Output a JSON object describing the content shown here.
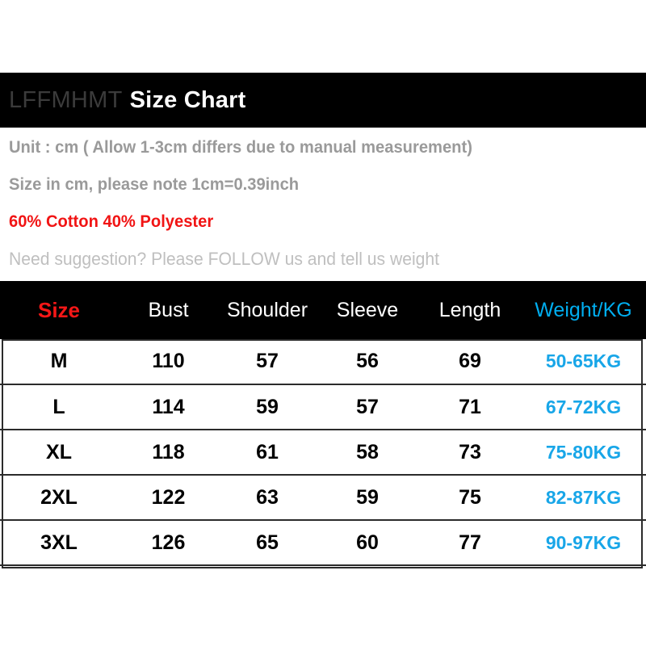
{
  "header": {
    "brand": "LFFMHMT",
    "title": "Size Chart"
  },
  "info": {
    "line_unit": "Unit : cm ( Allow 1-3cm differs due to manual measurement)",
    "line_conversion": "Size in cm, please note 1cm=0.39inch",
    "line_material": "60% Cotton 40% Polyester",
    "line_suggestion": "Need suggestion? Please FOLLOW us and tell us weight"
  },
  "colors": {
    "accent_red": "#f51717",
    "accent_cyan": "#00aef0",
    "header_bg": "#000000",
    "body_text": "#000000",
    "muted_gray": "#9a9a9a",
    "light_gray": "#bfbfbf"
  },
  "chart_data": {
    "type": "table",
    "title": "Size Chart",
    "columns": [
      "Size",
      "Bust",
      "Shoulder",
      "Sleeve",
      "Length",
      "Weight/KG"
    ],
    "rows": [
      [
        "M",
        "110",
        "57",
        "56",
        "69",
        "50-65KG"
      ],
      [
        "L",
        "114",
        "59",
        "57",
        "71",
        "67-72KG"
      ],
      [
        "XL",
        "118",
        "61",
        "58",
        "73",
        "75-80KG"
      ],
      [
        "2XL",
        "122",
        "63",
        "59",
        "75",
        "82-87KG"
      ],
      [
        "3XL",
        "126",
        "65",
        "60",
        "77",
        "90-97KG"
      ]
    ],
    "units": "cm",
    "notes": [
      "Unit : cm ( Allow 1-3cm differs due to manual measurement)",
      "Size in cm, please note 1cm=0.39inch",
      "60% Cotton 40% Polyester",
      "Need suggestion? Please FOLLOW us and tell us weight"
    ]
  }
}
